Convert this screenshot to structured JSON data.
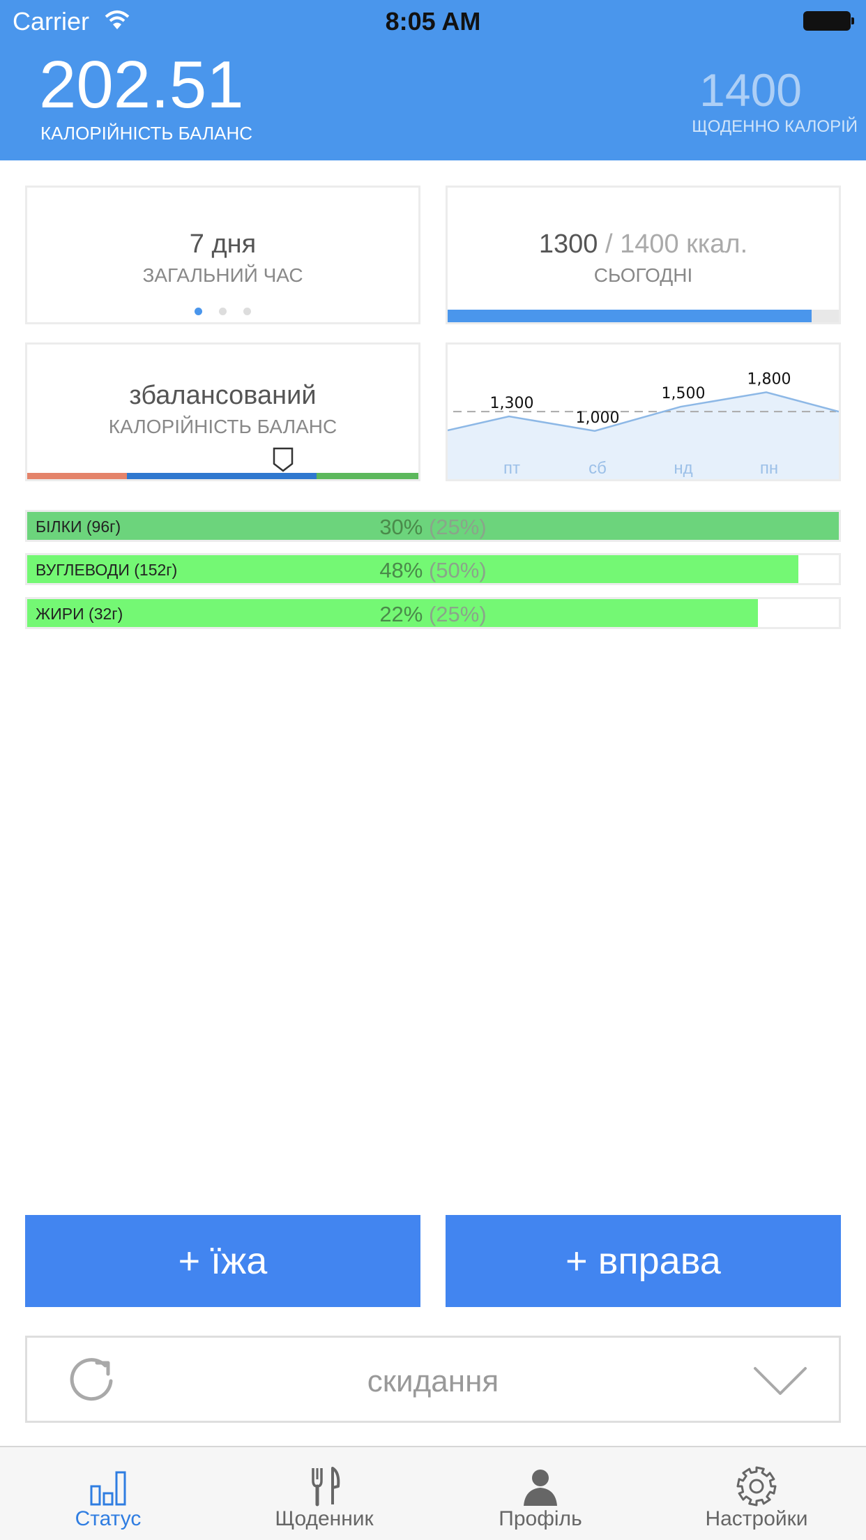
{
  "status_bar": {
    "carrier": "Carrier",
    "time": "8:05 AM"
  },
  "header": {
    "balance_value": "202.51",
    "balance_label": "КАЛОРІЙНІСТЬ БАЛАНС",
    "daily_value": "1400",
    "daily_label": "ЩОДЕННО КАЛОРІЙ"
  },
  "cards": {
    "time": {
      "value": "7 дня",
      "label": "ЗАГАЛЬНИЙ ЧАС",
      "page_count": 3,
      "active_page": 0
    },
    "today": {
      "consumed": "1300",
      "separator": " / ",
      "target": "1400 ккал.",
      "label": "СЬОГОДНІ",
      "progress": 0.93
    },
    "balance": {
      "value": "збалансований",
      "label": "КАЛОРІЙНІСТЬ БАЛАНС",
      "marker_position": 0.655
    }
  },
  "chart_data": {
    "type": "area",
    "categories": [
      "пт",
      "сб",
      "нд",
      "пн"
    ],
    "values": [
      1300,
      1000,
      1500,
      1800
    ],
    "value_labels": [
      "1,300",
      "1,000",
      "1,500",
      "1,800"
    ],
    "reference_line": 1400,
    "ylim": [
      0,
      2500
    ]
  },
  "macros": [
    {
      "name": "БІЛКИ (96г)",
      "percent": "30%",
      "target": "(25%)",
      "fill": 1.0
    },
    {
      "name": "ВУГЛЕВОДИ (152г)",
      "percent": "48%",
      "target": "(50%)",
      "fill": 0.95
    },
    {
      "name": "ЖИРИ (32г)",
      "percent": "22%",
      "target": "(25%)",
      "fill": 0.9
    }
  ],
  "actions": {
    "add_food": "+ їжа",
    "add_exercise": "+ вправа"
  },
  "reset": {
    "label": "скидання"
  },
  "tabs": [
    {
      "label": "Статус",
      "icon": "bar-chart-icon",
      "active": true
    },
    {
      "label": "Щоденник",
      "icon": "fork-knife-icon",
      "active": false
    },
    {
      "label": "Профіль",
      "icon": "person-icon",
      "active": false
    },
    {
      "label": "Настройки",
      "icon": "gear-icon",
      "active": false
    }
  ],
  "colors": {
    "accent": "#4a96ec",
    "button": "#4285f0",
    "scale_low": "#e4836a",
    "scale_mid": "#2f78cf",
    "scale_high": "#5cb85c",
    "macro_green": "#74f874",
    "macro_green_dark": "#6cd47c"
  }
}
